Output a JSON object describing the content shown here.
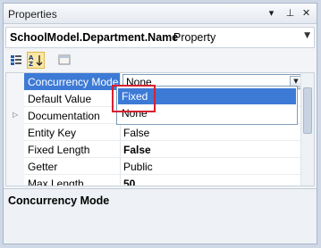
{
  "window": {
    "title": "Properties"
  },
  "titlebar_buttons": [
    "▾",
    "⊥",
    "✕"
  ],
  "object_selector": {
    "name": "SchoolModel.Department.Name",
    "type": "Property"
  },
  "toolbar": {
    "categorized_icon": "categorized-icon",
    "alphabetical_icon": "alphabetical-sort-icon",
    "pages_icon": "property-pages-icon"
  },
  "properties": [
    {
      "name": "Concurrency Mode",
      "value": "None",
      "selected": true
    },
    {
      "name": "Default Value",
      "value": ""
    },
    {
      "name": "Documentation",
      "value": "",
      "expandable": true
    },
    {
      "name": "Entity Key",
      "value": "False"
    },
    {
      "name": "Fixed Length",
      "value": "False",
      "bold": true
    },
    {
      "name": "Getter",
      "value": "Public"
    },
    {
      "name": "Max Length",
      "value": "50",
      "bold": true
    }
  ],
  "dropdown": {
    "options": [
      "Fixed",
      "None"
    ],
    "highlighted": "Fixed"
  },
  "description": {
    "title": "Concurrency Mode"
  }
}
